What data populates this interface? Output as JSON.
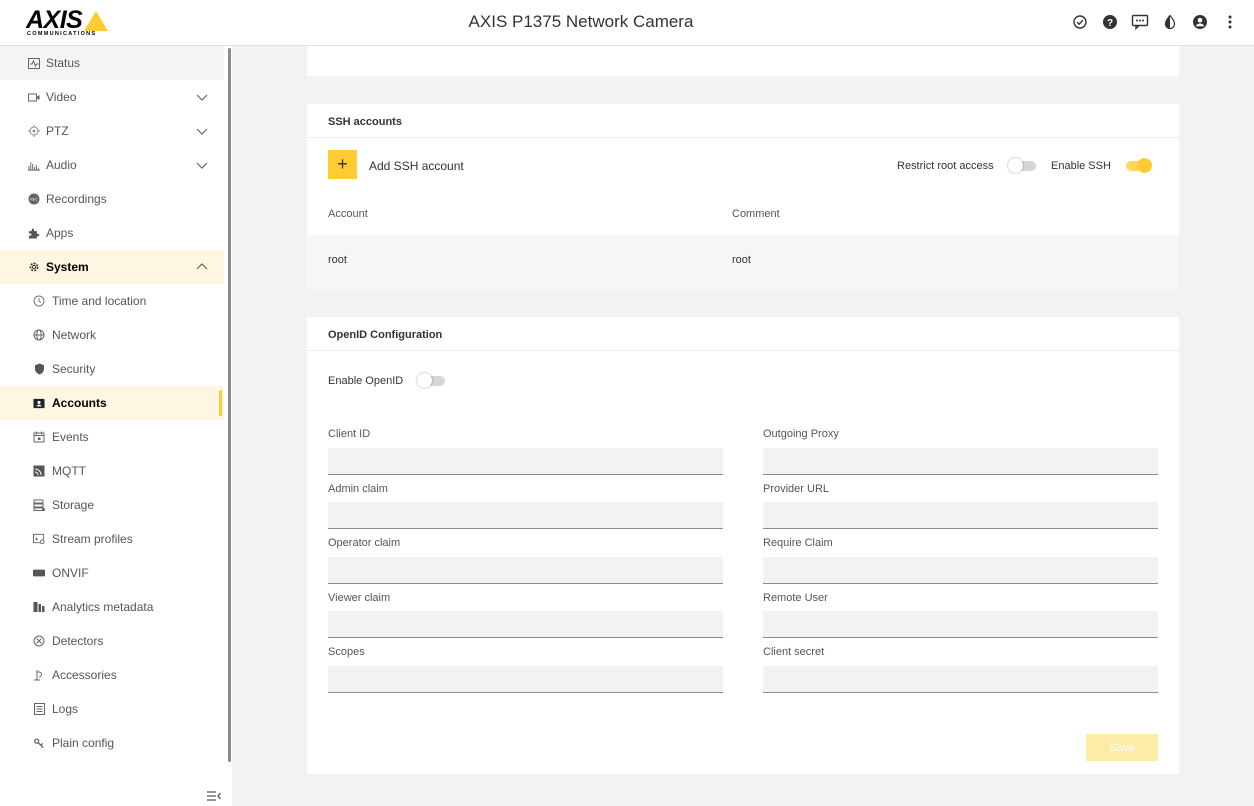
{
  "header": {
    "logo_text": "AXIS",
    "logo_sub": "COMMUNICATIONS",
    "title": "AXIS P1375 Network Camera",
    "icons": [
      "settings-check-icon",
      "help-icon",
      "feedback-icon",
      "contrast-icon",
      "account-icon",
      "more-icon"
    ]
  },
  "sidebar": {
    "items": [
      {
        "label": "Status",
        "icon": "status-icon"
      },
      {
        "label": "Video",
        "icon": "video-icon",
        "expandable": true
      },
      {
        "label": "PTZ",
        "icon": "ptz-icon",
        "expandable": true
      },
      {
        "label": "Audio",
        "icon": "audio-icon",
        "expandable": true
      },
      {
        "label": "Recordings",
        "icon": "recordings-icon"
      },
      {
        "label": "Apps",
        "icon": "apps-icon"
      },
      {
        "label": "System",
        "icon": "system-icon",
        "expanded": true
      },
      {
        "label": "Time and location",
        "icon": "time-icon"
      },
      {
        "label": "Network",
        "icon": "network-icon"
      },
      {
        "label": "Security",
        "icon": "security-icon"
      },
      {
        "label": "Accounts",
        "icon": "accounts-icon",
        "selected": true
      },
      {
        "label": "Events",
        "icon": "events-icon"
      },
      {
        "label": "MQTT",
        "icon": "mqtt-icon"
      },
      {
        "label": "Storage",
        "icon": "storage-icon"
      },
      {
        "label": "Stream profiles",
        "icon": "stream-profiles-icon"
      },
      {
        "label": "ONVIF",
        "icon": "onvif-icon"
      },
      {
        "label": "Analytics metadata",
        "icon": "analytics-icon"
      },
      {
        "label": "Detectors",
        "icon": "detectors-icon"
      },
      {
        "label": "Accessories",
        "icon": "accessories-icon"
      },
      {
        "label": "Logs",
        "icon": "logs-icon"
      },
      {
        "label": "Plain config",
        "icon": "plain-config-icon"
      }
    ]
  },
  "ssh": {
    "title": "SSH accounts",
    "add_label": "Add SSH account",
    "restrict_root_label": "Restrict root access",
    "restrict_root_on": false,
    "enable_ssh_label": "Enable SSH",
    "enable_ssh_on": true,
    "columns": [
      "Account",
      "Comment"
    ],
    "rows": [
      {
        "account": "root",
        "comment": "root"
      }
    ]
  },
  "openid": {
    "title": "OpenID Configuration",
    "enable_label": "Enable OpenID",
    "enable_on": false,
    "fields": {
      "client_id": {
        "label": "Client ID",
        "value": ""
      },
      "outgoing_proxy": {
        "label": "Outgoing Proxy",
        "value": ""
      },
      "admin_claim": {
        "label": "Admin claim",
        "value": ""
      },
      "provider_url": {
        "label": "Provider URL",
        "value": ""
      },
      "operator_claim": {
        "label": "Operator claim",
        "value": ""
      },
      "require_claim": {
        "label": "Require Claim",
        "value": ""
      },
      "viewer_claim": {
        "label": "Viewer claim",
        "value": ""
      },
      "remote_user": {
        "label": "Remote User",
        "value": ""
      },
      "scopes": {
        "label": "Scopes",
        "value": ""
      },
      "client_secret": {
        "label": "Client secret",
        "value": ""
      }
    },
    "save_label": "Save"
  },
  "colors": {
    "accent": "#ffcc33",
    "selected_bg": "#fdf6e0",
    "page_bg": "#f2f2f2"
  }
}
